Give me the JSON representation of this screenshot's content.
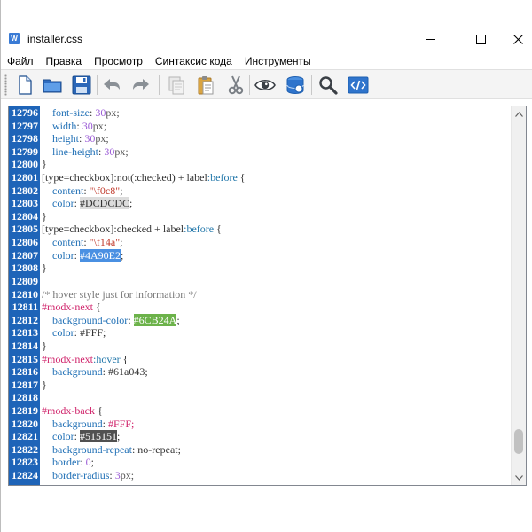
{
  "window": {
    "title": "installer.css",
    "app_icon": "W"
  },
  "menu": [
    "Файл",
    "Правка",
    "Просмотр",
    "Синтаксис кода",
    "Инструменты"
  ],
  "toolbar": {
    "buttons": [
      "new-file",
      "open-folder",
      "save",
      "undo",
      "redo",
      "copy",
      "paste",
      "cut",
      "preview",
      "database",
      "search",
      "html-code"
    ]
  },
  "editor": {
    "lines": [
      {
        "n": "12796",
        "code": [
          {
            "t": "    ",
            "c": "plain"
          },
          {
            "t": "font-size",
            "c": "prop"
          },
          {
            "t": ": ",
            "c": "plain"
          },
          {
            "t": "30",
            "c": "num"
          },
          {
            "t": "px;",
            "c": "unit"
          }
        ]
      },
      {
        "n": "12797",
        "code": [
          {
            "t": "    ",
            "c": "plain"
          },
          {
            "t": "width",
            "c": "prop"
          },
          {
            "t": ": ",
            "c": "plain"
          },
          {
            "t": "30",
            "c": "num"
          },
          {
            "t": "px;",
            "c": "unit"
          }
        ]
      },
      {
        "n": "12798",
        "code": [
          {
            "t": "    ",
            "c": "plain"
          },
          {
            "t": "height",
            "c": "prop"
          },
          {
            "t": ": ",
            "c": "plain"
          },
          {
            "t": "30",
            "c": "num"
          },
          {
            "t": "px;",
            "c": "unit"
          }
        ]
      },
      {
        "n": "12799",
        "code": [
          {
            "t": "    ",
            "c": "plain"
          },
          {
            "t": "line-height",
            "c": "prop"
          },
          {
            "t": ": ",
            "c": "plain"
          },
          {
            "t": "30",
            "c": "num"
          },
          {
            "t": "px;",
            "c": "unit"
          }
        ]
      },
      {
        "n": "12800",
        "code": [
          {
            "t": "}",
            "c": "plain"
          }
        ]
      },
      {
        "n": "12801",
        "code": [
          {
            "t": "[type=checkbox]",
            "c": "sel"
          },
          {
            "t": ":not(:checked) + label",
            "c": "sel"
          },
          {
            "t": ":before",
            "c": "pseudo"
          },
          {
            "t": " {",
            "c": "plain"
          }
        ]
      },
      {
        "n": "12802",
        "code": [
          {
            "t": "    ",
            "c": "plain"
          },
          {
            "t": "content",
            "c": "prop"
          },
          {
            "t": ": ",
            "c": "plain"
          },
          {
            "t": "\"\\f0c8\"",
            "c": "str"
          },
          {
            "t": ";",
            "c": "plain"
          }
        ]
      },
      {
        "n": "12803",
        "code": [
          {
            "t": "    ",
            "c": "plain"
          },
          {
            "t": "color",
            "c": "prop"
          },
          {
            "t": ": ",
            "c": "plain"
          },
          {
            "t": "#DCDCDC",
            "c": "hex",
            "bg": "#DCDCDC",
            "fg": "#333333"
          },
          {
            "t": ";",
            "c": "plain"
          }
        ]
      },
      {
        "n": "12804",
        "code": [
          {
            "t": "}",
            "c": "plain"
          }
        ]
      },
      {
        "n": "12805",
        "code": [
          {
            "t": "[type=checkbox]",
            "c": "sel"
          },
          {
            "t": ":checked + label",
            "c": "sel"
          },
          {
            "t": ":before",
            "c": "pseudo"
          },
          {
            "t": " {",
            "c": "plain"
          }
        ]
      },
      {
        "n": "12806",
        "code": [
          {
            "t": "    ",
            "c": "plain"
          },
          {
            "t": "content",
            "c": "prop"
          },
          {
            "t": ": ",
            "c": "plain"
          },
          {
            "t": "\"\\f14a\"",
            "c": "str"
          },
          {
            "t": ";",
            "c": "plain"
          }
        ]
      },
      {
        "n": "12807",
        "code": [
          {
            "t": "    ",
            "c": "plain"
          },
          {
            "t": "color",
            "c": "prop"
          },
          {
            "t": ": ",
            "c": "plain"
          },
          {
            "t": "#4A90E2",
            "c": "hex",
            "bg": "#4A90E2",
            "fg": "#ffffff"
          },
          {
            "t": ";",
            "c": "plain"
          }
        ]
      },
      {
        "n": "12808",
        "code": [
          {
            "t": "}",
            "c": "plain"
          }
        ]
      },
      {
        "n": "12809",
        "code": []
      },
      {
        "n": "12810",
        "code": [
          {
            "t": "/* hover style just for information */",
            "c": "comment"
          }
        ]
      },
      {
        "n": "12811",
        "code": [
          {
            "t": "#modx-next",
            "c": "id"
          },
          {
            "t": " {",
            "c": "plain"
          }
        ]
      },
      {
        "n": "12812",
        "code": [
          {
            "t": "    ",
            "c": "plain"
          },
          {
            "t": "background-color",
            "c": "prop"
          },
          {
            "t": ": ",
            "c": "plain"
          },
          {
            "t": "#6CB24A",
            "c": "hex",
            "bg": "#6CB24A",
            "fg": "#ffffff"
          },
          {
            "t": ";",
            "c": "plain"
          }
        ]
      },
      {
        "n": "12813",
        "code": [
          {
            "t": "    ",
            "c": "plain"
          },
          {
            "t": "color",
            "c": "prop"
          },
          {
            "t": ": ",
            "c": "plain"
          },
          {
            "t": "#FFF;",
            "c": "plain"
          }
        ]
      },
      {
        "n": "12814",
        "code": [
          {
            "t": "}",
            "c": "plain"
          }
        ]
      },
      {
        "n": "12815",
        "code": [
          {
            "t": "#modx-next",
            "c": "id"
          },
          {
            "t": ":hover",
            "c": "pseudo"
          },
          {
            "t": " {",
            "c": "plain"
          }
        ]
      },
      {
        "n": "12816",
        "code": [
          {
            "t": "    ",
            "c": "plain"
          },
          {
            "t": "background",
            "c": "prop"
          },
          {
            "t": ": ",
            "c": "plain"
          },
          {
            "t": "#61a043;",
            "c": "plain"
          }
        ]
      },
      {
        "n": "12817",
        "code": [
          {
            "t": "}",
            "c": "plain"
          }
        ]
      },
      {
        "n": "12818",
        "code": []
      },
      {
        "n": "12819",
        "code": [
          {
            "t": "#modx-back",
            "c": "id"
          },
          {
            "t": " {",
            "c": "plain"
          }
        ]
      },
      {
        "n": "12820",
        "code": [
          {
            "t": "    ",
            "c": "plain"
          },
          {
            "t": "background",
            "c": "prop"
          },
          {
            "t": ": ",
            "c": "plain"
          },
          {
            "t": "#FFF;",
            "c": "id"
          }
        ]
      },
      {
        "n": "12821",
        "code": [
          {
            "t": "    ",
            "c": "plain"
          },
          {
            "t": "color",
            "c": "prop"
          },
          {
            "t": ": ",
            "c": "plain"
          },
          {
            "t": "#515151",
            "c": "hex",
            "bg": "#515151",
            "fg": "#ffffff"
          },
          {
            "t": ";",
            "c": "plain"
          }
        ]
      },
      {
        "n": "12822",
        "code": [
          {
            "t": "    ",
            "c": "plain"
          },
          {
            "t": "background-repeat",
            "c": "prop"
          },
          {
            "t": ": ",
            "c": "plain"
          },
          {
            "t": "no-repeat;",
            "c": "plain"
          }
        ]
      },
      {
        "n": "12823",
        "code": [
          {
            "t": "    ",
            "c": "plain"
          },
          {
            "t": "border",
            "c": "prop"
          },
          {
            "t": ": ",
            "c": "plain"
          },
          {
            "t": "0",
            "c": "num"
          },
          {
            "t": ";",
            "c": "plain"
          }
        ]
      },
      {
        "n": "12824",
        "code": [
          {
            "t": "    ",
            "c": "plain"
          },
          {
            "t": "border-radius",
            "c": "prop"
          },
          {
            "t": ": ",
            "c": "plain"
          },
          {
            "t": "3",
            "c": "num"
          },
          {
            "t": "px;",
            "c": "unit"
          }
        ]
      }
    ]
  },
  "colors": {
    "gutter": "#1e64b8",
    "property": "#1f6fb5",
    "number": "#9b5cd6",
    "selector_id": "#d0246b",
    "string": "#c0392b"
  }
}
